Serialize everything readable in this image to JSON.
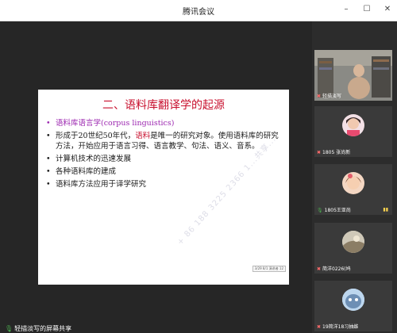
{
  "window": {
    "title": "腾讯会议"
  },
  "slide": {
    "title": "二、语料库翻译学的起源",
    "bullet1": "语料库语言学(corpus linguistics)",
    "bullet2_pre": "形成于20世纪50年代，",
    "bullet2_hl": "语料",
    "bullet2_post": "是唯一的研究对象。使用语料库的研究方法，开始应用于语言习得、语言教学、句法、语义、音系。",
    "bullet3": "计算机技术的迅速发展",
    "bullet4": "各种语料库的建成",
    "bullet5": "语料库方法应用于译学研究",
    "watermark": "+ 86 188 3225 2366   1...共享...",
    "tag": "3/29 8/1 演讲者 12"
  },
  "share": {
    "caption": "轻描淡写的屏幕共享"
  },
  "participants": [
    {
      "name": "轻描淡写",
      "mic": "muted"
    },
    {
      "name": "1805 张尚新",
      "mic": "muted"
    },
    {
      "name": "1805王亚尚",
      "mic": "on"
    },
    {
      "name": "简洋0226(鸠",
      "mic": "muted"
    },
    {
      "name": "19简洋18习抽雌",
      "mic": "muted"
    }
  ],
  "colors": {
    "accent_red": "#c8102e",
    "purple": "#9c27b0"
  }
}
